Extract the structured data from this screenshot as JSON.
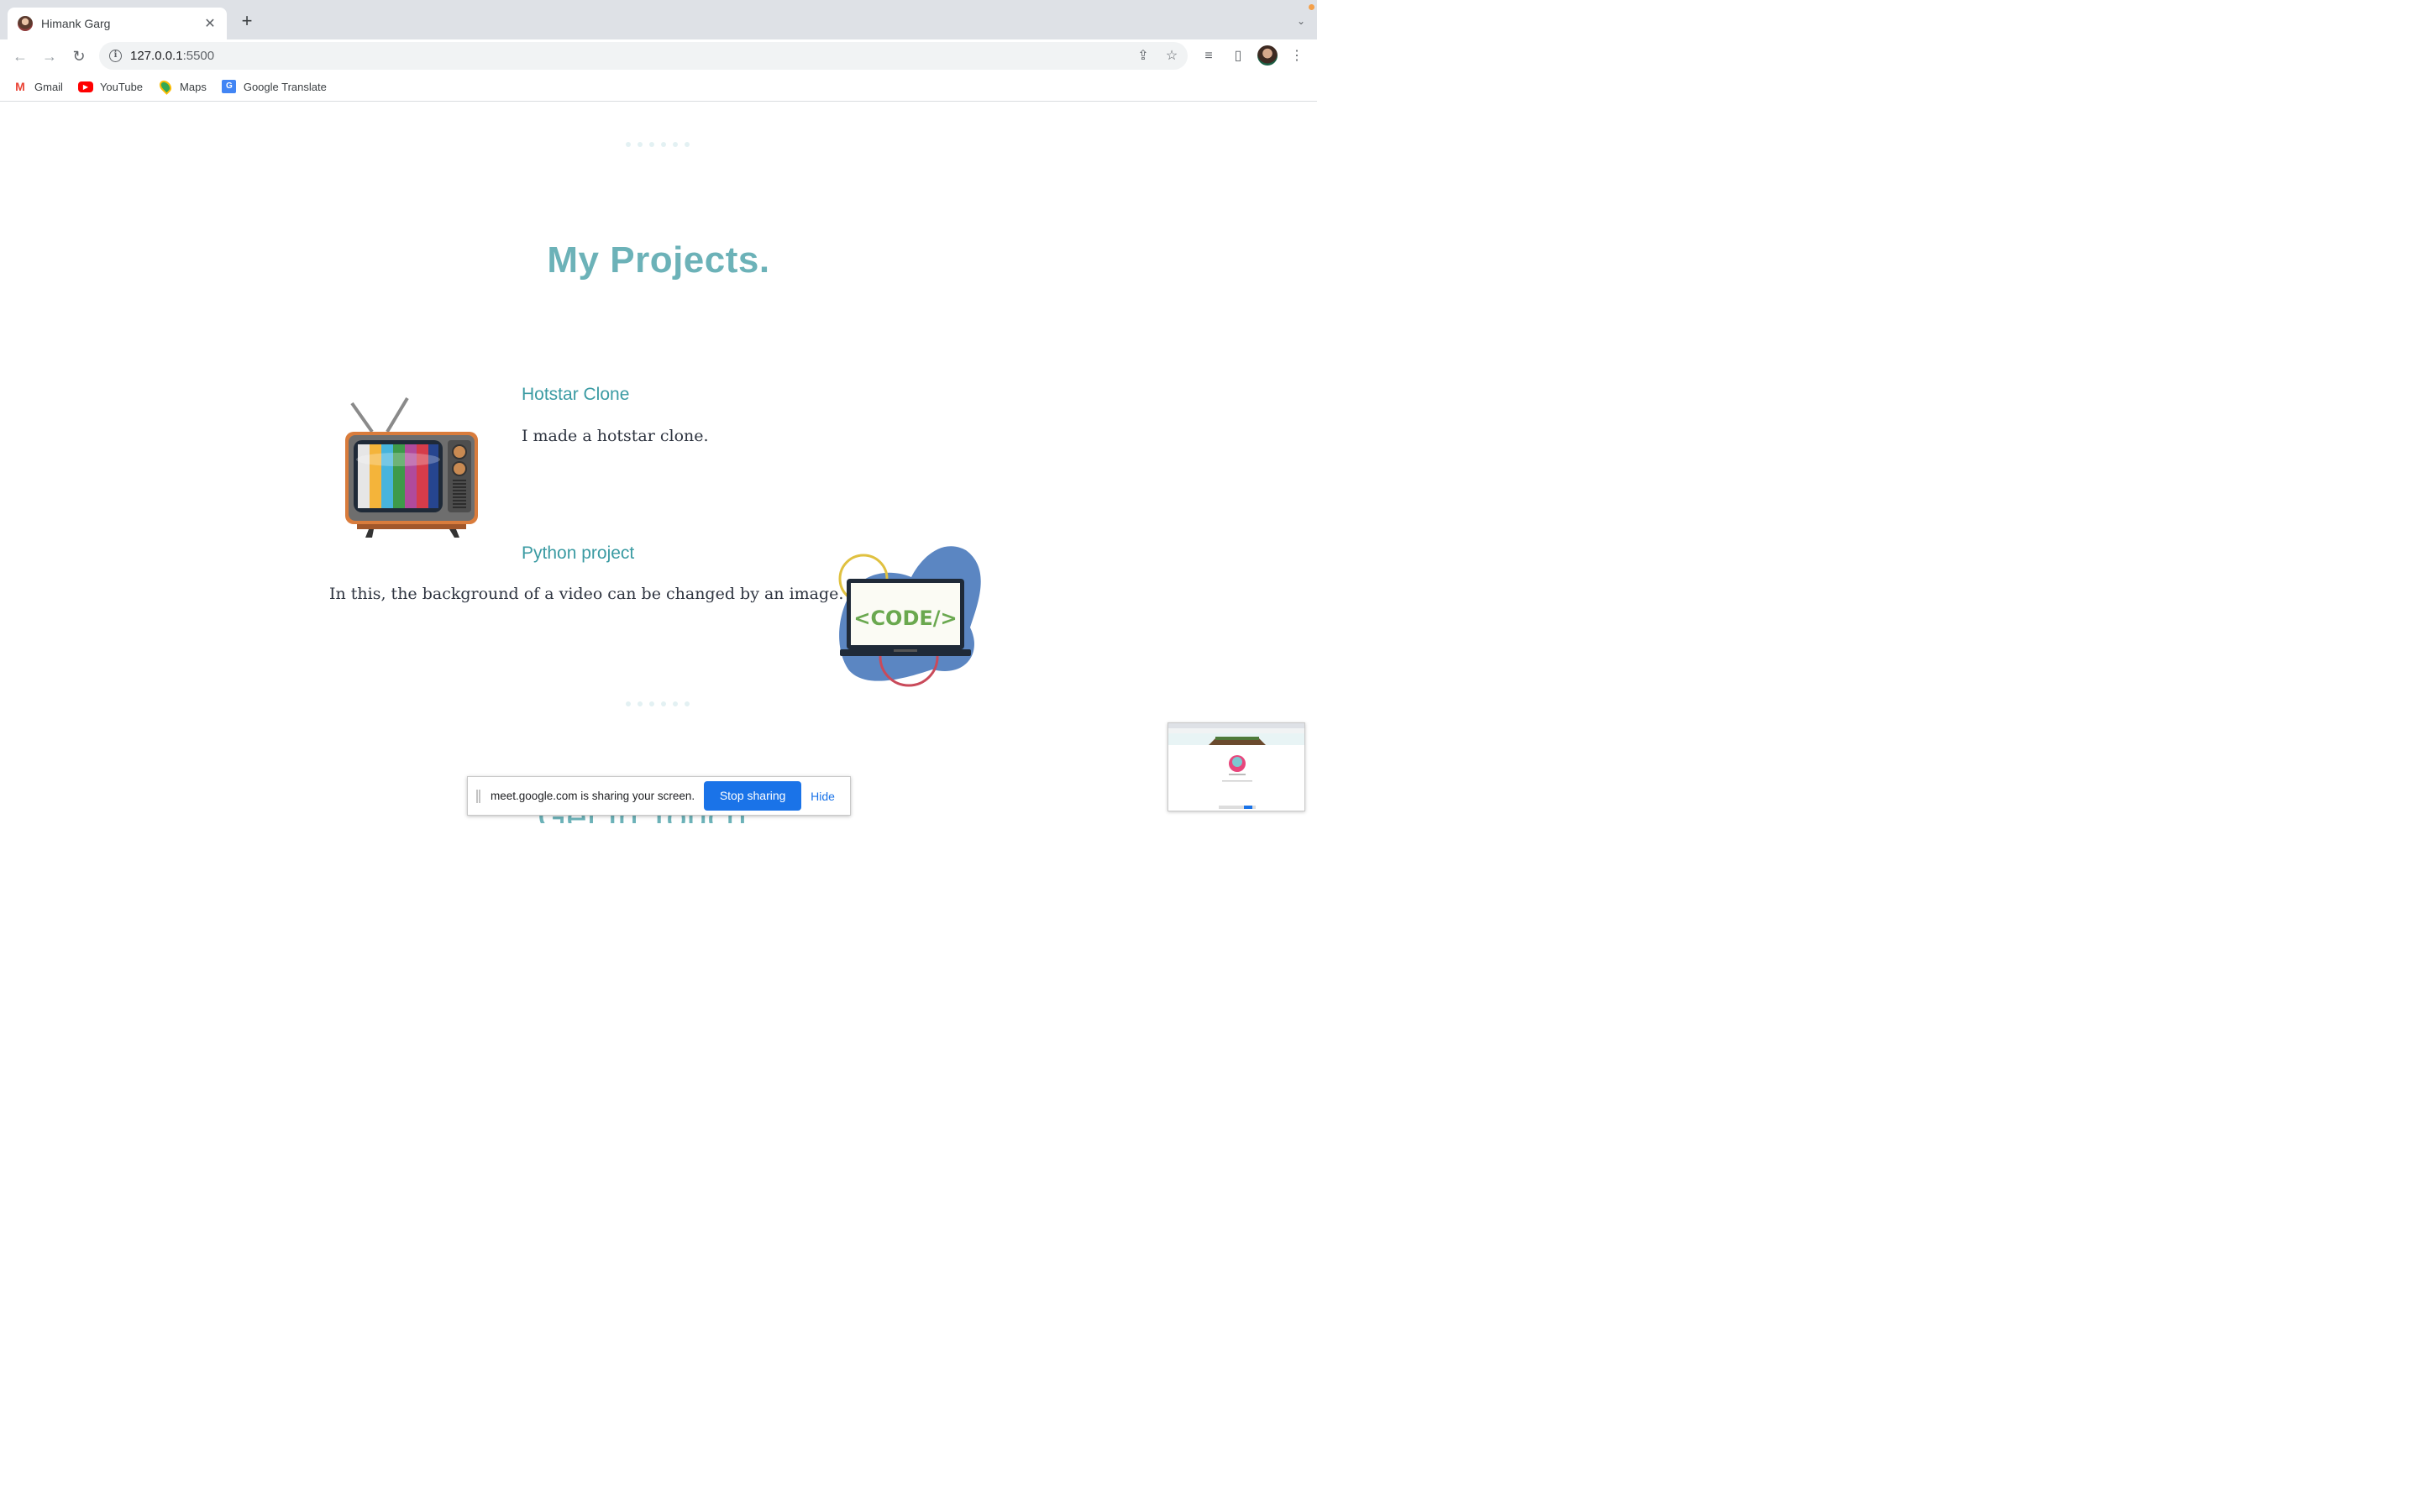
{
  "browser": {
    "tab_title": "Himank Garg",
    "url_host": "127.0.0.1",
    "url_port": ":5500",
    "bookmarks": [
      {
        "label": "Gmail",
        "icon": "gmail-icon"
      },
      {
        "label": "YouTube",
        "icon": "youtube-icon"
      },
      {
        "label": "Maps",
        "icon": "maps-icon"
      },
      {
        "label": "Google Translate",
        "icon": "google-translate-icon"
      }
    ]
  },
  "page": {
    "section_title": "My Projects.",
    "projects": [
      {
        "title": "Hotstar Clone",
        "description": "I made a hotstar clone.",
        "image_icon": "retro-tv-icon"
      },
      {
        "title": "Python project",
        "description": "In this, the background of a video can be changed by an image.",
        "image_icon": "code-laptop-icon",
        "image_text": "<CODE/>"
      }
    ],
    "next_section_title": "Get In Touch"
  },
  "screen_share": {
    "message": "meet.google.com is sharing your screen.",
    "stop_label": "Stop sharing",
    "hide_label": "Hide"
  },
  "colors": {
    "accent": "#6cb2b8",
    "project_title": "#3b9ba3",
    "share_button": "#1a73e8"
  }
}
